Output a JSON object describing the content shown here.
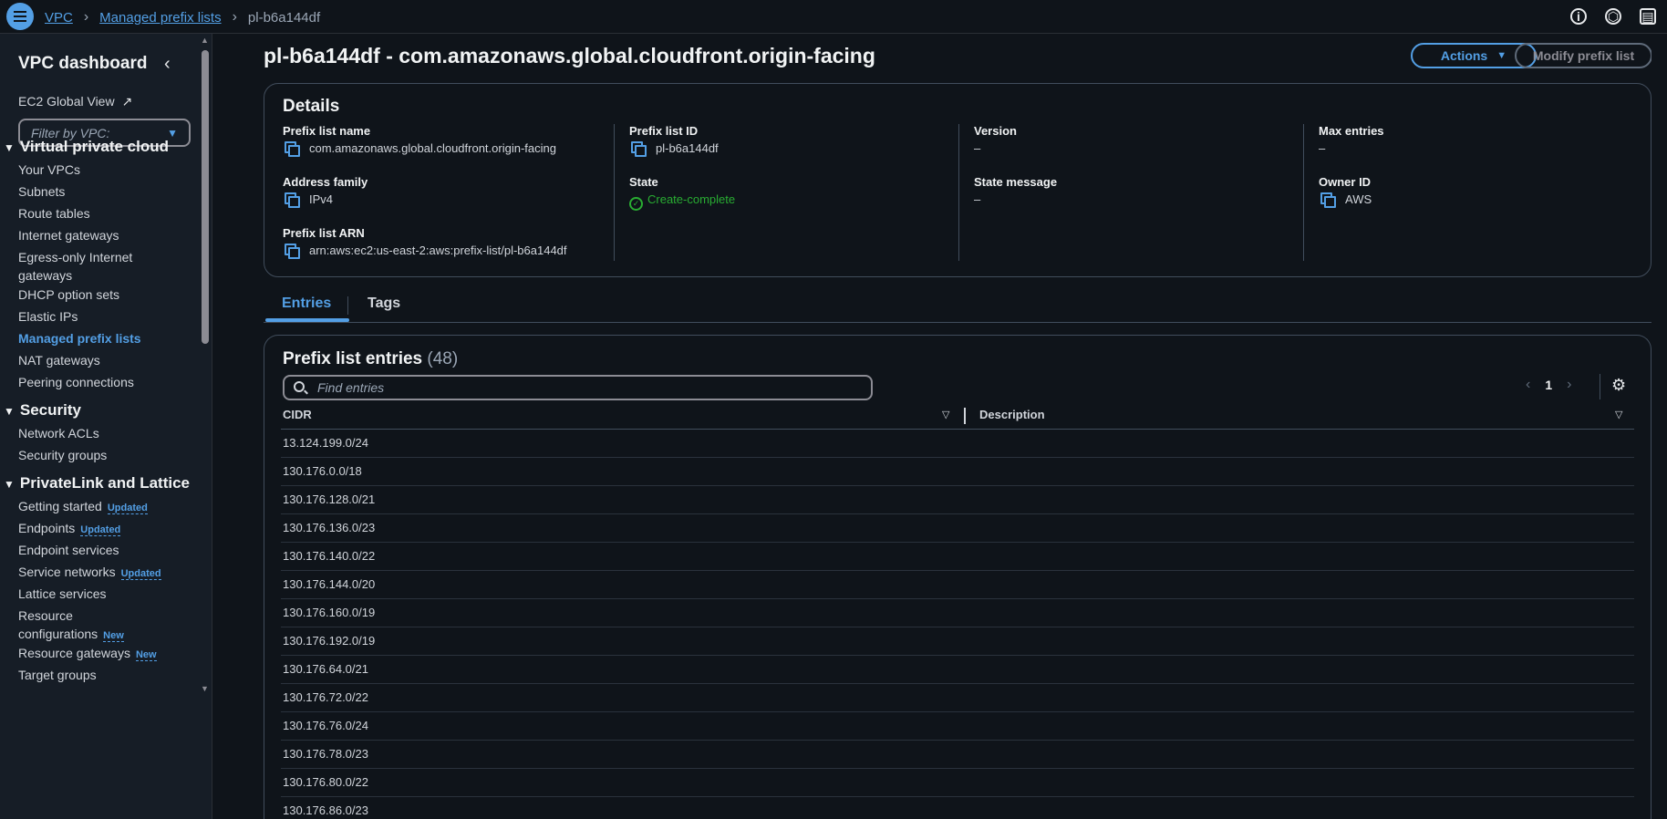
{
  "breadcrumb": {
    "root": "VPC",
    "parent": "Managed prefix lists",
    "current": "pl-b6a144df"
  },
  "sidebar": {
    "title": "VPC dashboard",
    "ec2_global_view": "EC2 Global View",
    "filter_placeholder": "Filter by VPC:",
    "sections": [
      {
        "title": "Virtual private cloud",
        "items": [
          "Your VPCs",
          "Subnets",
          "Route tables",
          "Internet gateways",
          "Egress-only Internet gateways",
          "DHCP option sets",
          "Elastic IPs",
          "Managed prefix lists",
          "NAT gateways",
          "Peering connections"
        ]
      },
      {
        "title": "Security",
        "items": [
          "Network ACLs",
          "Security groups"
        ]
      },
      {
        "title": "PrivateLink and Lattice",
        "items": [
          "Getting started",
          "Endpoints",
          "Endpoint services",
          "Service networks",
          "Lattice services",
          "Resource configurations",
          "Resource gateways",
          "Target groups"
        ]
      }
    ],
    "egress_line1": "Egress-only Internet",
    "egress_line2": "gateways",
    "resource_conf_line1": "Resource",
    "resource_conf_line2": "configurations",
    "badge_updated": "Updated",
    "badge_new": "New"
  },
  "page": {
    "title": "pl-b6a144df - com.amazonaws.global.cloudfront.origin-facing",
    "actions_label": "Actions",
    "modify_label": "Modify prefix list"
  },
  "details": {
    "heading": "Details",
    "prefix_list_name_label": "Prefix list name",
    "prefix_list_name": "com.amazonaws.global.cloudfront.origin-facing",
    "address_family_label": "Address family",
    "address_family": "IPv4",
    "arn_label": "Prefix list ARN",
    "arn": "arn:aws:ec2:us-east-2:aws:prefix-list/pl-b6a144df",
    "id_label": "Prefix list ID",
    "id": "pl-b6a144df",
    "state_label": "State",
    "state": "Create-complete",
    "version_label": "Version",
    "version": "–",
    "state_message_label": "State message",
    "state_message": "–",
    "max_entries_label": "Max entries",
    "max_entries": "–",
    "owner_label": "Owner ID",
    "owner": "AWS"
  },
  "tabs": [
    "Entries",
    "Tags"
  ],
  "entries": {
    "heading": "Prefix list entries",
    "count": "(48)",
    "search_placeholder": "Find entries",
    "page": "1",
    "columns": [
      "CIDR",
      "Description"
    ],
    "rows": [
      "13.124.199.0/24",
      "130.176.0.0/18",
      "130.176.128.0/21",
      "130.176.136.0/23",
      "130.176.140.0/22",
      "130.176.144.0/20",
      "130.176.160.0/19",
      "130.176.192.0/19",
      "130.176.64.0/21",
      "130.176.72.0/22",
      "130.176.76.0/24",
      "130.176.78.0/23",
      "130.176.80.0/22",
      "130.176.86.0/23"
    ]
  },
  "colors": {
    "accent": "#539fe5",
    "success": "#29ad32",
    "background": "#0f141a",
    "sidebar": "#161d26"
  }
}
